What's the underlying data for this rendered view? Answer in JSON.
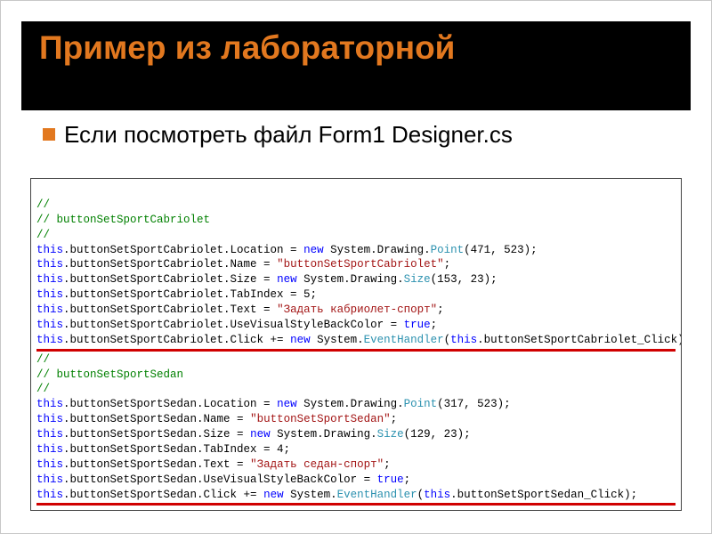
{
  "title": "Пример из лабораторной",
  "bullet": "Если посмотреть файл Form1 Designer.cs",
  "code": {
    "c1": "//",
    "c2": "// buttonSetSportCabriolet",
    "c3": "//",
    "l1a": "this",
    "l1b": ".buttonSetSportCabriolet.Location = ",
    "l1c": "new",
    "l1d": " System.Drawing.",
    "l1e": "Point",
    "l1f": "(471, 523);",
    "l2a": "this",
    "l2b": ".buttonSetSportCabriolet.Name = ",
    "l2c": "\"buttonSetSportCabriolet\"",
    "l2d": ";",
    "l3a": "this",
    "l3b": ".buttonSetSportCabriolet.Size = ",
    "l3c": "new",
    "l3d": " System.Drawing.",
    "l3e": "Size",
    "l3f": "(153, 23);",
    "l4a": "this",
    "l4b": ".buttonSetSportCabriolet.TabIndex = 5;",
    "l5a": "this",
    "l5b": ".buttonSetSportCabriolet.Text = ",
    "l5c": "\"Задать кабриолет-спорт\"",
    "l5d": ";",
    "l6a": "this",
    "l6b": ".buttonSetSportCabriolet.UseVisualStyleBackColor = ",
    "l6c": "true",
    "l6d": ";",
    "l7a": "this",
    "l7b": ".buttonSetSportCabriolet.Click += ",
    "l7c": "new",
    "l7d": " System.",
    "l7e": "EventHandler",
    "l7f": "(",
    "l7g": "this",
    "l7h": ".buttonSetSportCabriolet_Click);",
    "c4": "//",
    "c5": "// buttonSetSportSedan",
    "c6": "//",
    "m1a": "this",
    "m1b": ".buttonSetSportSedan.Location = ",
    "m1c": "new",
    "m1d": " System.Drawing.",
    "m1e": "Point",
    "m1f": "(317, 523);",
    "m2a": "this",
    "m2b": ".buttonSetSportSedan.Name = ",
    "m2c": "\"buttonSetSportSedan\"",
    "m2d": ";",
    "m3a": "this",
    "m3b": ".buttonSetSportSedan.Size = ",
    "m3c": "new",
    "m3d": " System.Drawing.",
    "m3e": "Size",
    "m3f": "(129, 23);",
    "m4a": "this",
    "m4b": ".buttonSetSportSedan.TabIndex = 4;",
    "m5a": "this",
    "m5b": ".buttonSetSportSedan.Text = ",
    "m5c": "\"Задать седан-спорт\"",
    "m5d": ";",
    "m6a": "this",
    "m6b": ".buttonSetSportSedan.UseVisualStyleBackColor = ",
    "m6c": "true",
    "m6d": ";",
    "m7a": "this",
    "m7b": ".buttonSetSportSedan.Click += ",
    "m7c": "new",
    "m7d": " System.",
    "m7e": "EventHandler",
    "m7f": "(",
    "m7g": "this",
    "m7h": ".buttonSetSportSedan_Click);"
  }
}
